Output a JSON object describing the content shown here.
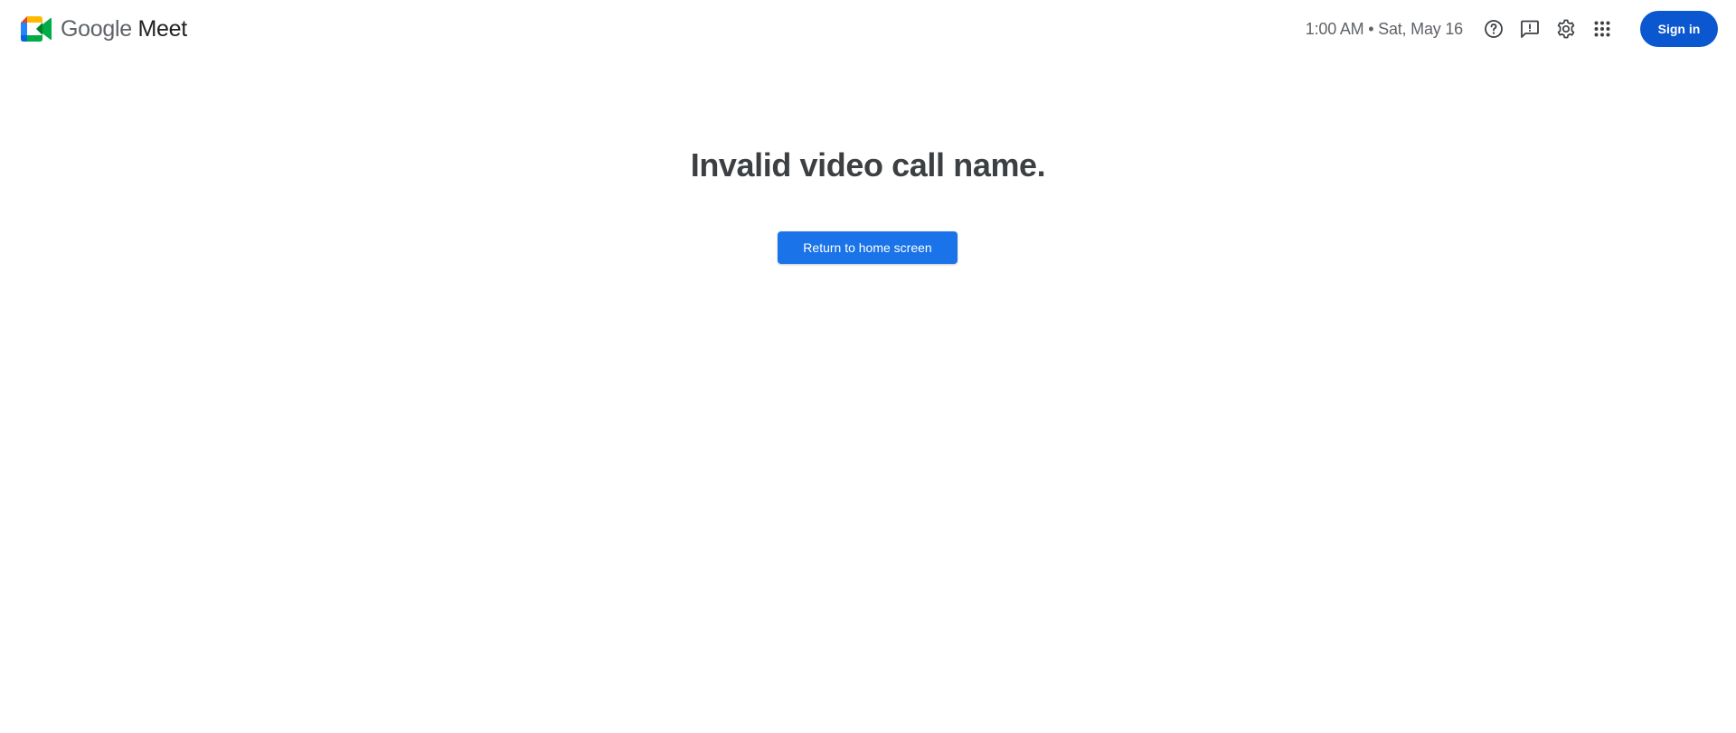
{
  "brand": {
    "company": "Google",
    "product": "Meet",
    "logo_icon": "google-meet-logo-icon",
    "colors": {
      "green": "#00832d",
      "blue": "#0066da",
      "yellow": "#ffba00",
      "red": "#e94235",
      "dark_green": "#00ac47"
    }
  },
  "header": {
    "clock": "1:00 AM • Sat, May 16",
    "icons": [
      "help-icon",
      "feedback-icon",
      "settings-icon",
      "apps-grid-icon"
    ],
    "signin_label": "Sign in",
    "signin_color": "#0b57d0"
  },
  "main": {
    "error_message": "Invalid video call name.",
    "return_button_label": "Return to home screen",
    "return_button_color": "#1a73e8"
  }
}
